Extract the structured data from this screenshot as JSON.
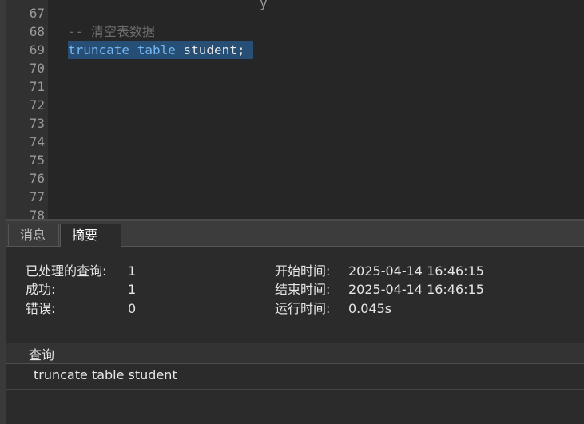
{
  "editor": {
    "partial_top_text": "y",
    "line_numbers": [
      "67",
      "68",
      "69",
      "70",
      "71",
      "72",
      "73",
      "74",
      "75",
      "76",
      "77",
      "78"
    ],
    "comment_line": "-- 清空表数据",
    "sql": {
      "kw1": "truncate",
      "kw2": "table",
      "ident": "student;"
    }
  },
  "tabs": [
    {
      "label": "消息",
      "active": false
    },
    {
      "label": "摘要",
      "active": true
    }
  ],
  "summary": {
    "processed_label": "已处理的查询:",
    "processed_value": "1",
    "success_label": "成功:",
    "success_value": "1",
    "error_label": "错误:",
    "error_value": "0",
    "start_label": "开始时间:",
    "start_value": "2025-04-14 16:46:15",
    "end_label": "结束时间:",
    "end_value": "2025-04-14 16:46:15",
    "run_label": "运行时间:",
    "run_value": "0.045s"
  },
  "query_table": {
    "header": "查询",
    "rows": [
      "truncate table student"
    ]
  }
}
